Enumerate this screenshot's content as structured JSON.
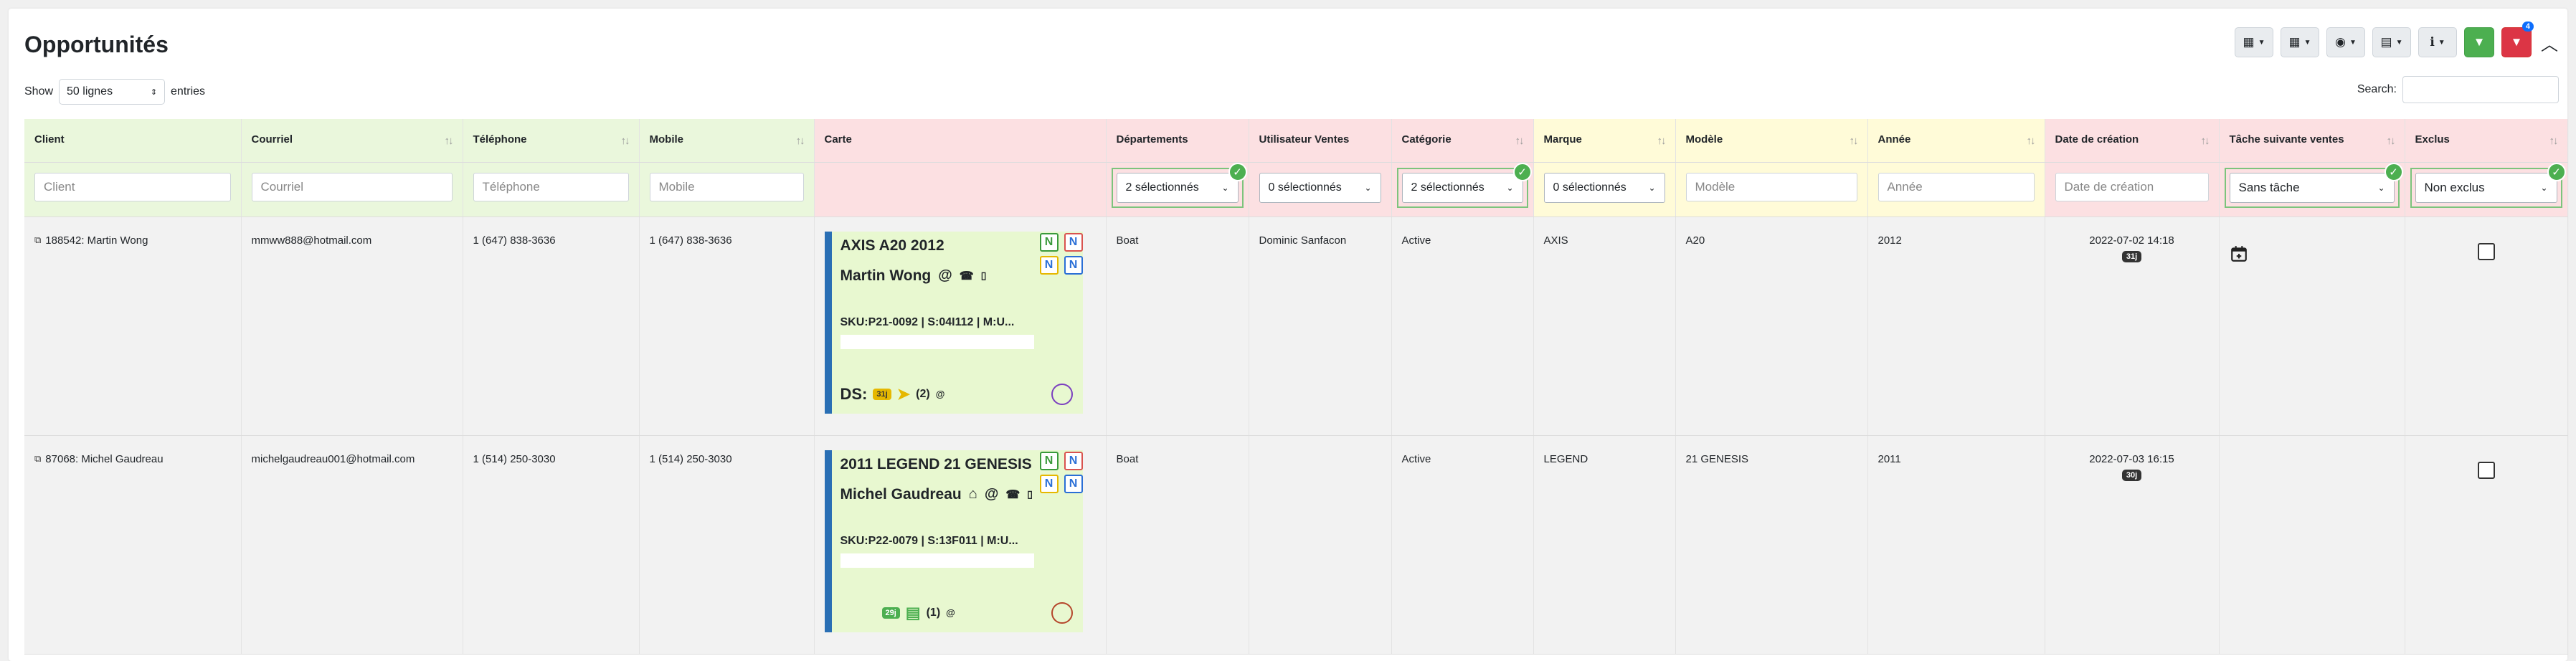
{
  "page": {
    "title": "Opportunités"
  },
  "toolbar": {
    "filter_count": "4"
  },
  "length": {
    "show": "Show",
    "value": "50 lignes",
    "entries": "entries"
  },
  "search": {
    "label": "Search:"
  },
  "columns": [
    {
      "label": "Client"
    },
    {
      "label": "Courriel"
    },
    {
      "label": "Téléphone"
    },
    {
      "label": "Mobile"
    },
    {
      "label": "Carte"
    },
    {
      "label": "Départements"
    },
    {
      "label": "Utilisateur Ventes"
    },
    {
      "label": "Catégorie"
    },
    {
      "label": "Marque"
    },
    {
      "label": "Modèle"
    },
    {
      "label": "Année"
    },
    {
      "label": "Date de création"
    },
    {
      "label": "Tâche suivante ventes"
    },
    {
      "label": "Exclus"
    }
  ],
  "filters": {
    "client": "Client",
    "courriel": "Courriel",
    "telephone": "Téléphone",
    "mobile": "Mobile",
    "departements": "2 sélectionnés",
    "utilisateur": "0 sélectionnés",
    "categorie": "2 sélectionnés",
    "marque": "0 sélectionnés",
    "modele": "Modèle",
    "annee": "Année",
    "date": "Date de création",
    "tache": "Sans tâche",
    "exclus": "Non exclus"
  },
  "rows": [
    {
      "client": "188542: Martin Wong",
      "courriel": "mmww888@hotmail.com",
      "telephone": "1 (647) 838-3636",
      "mobile": "1 (647) 838-3636",
      "card": {
        "title": "AXIS A20 2012",
        "name": "Martin Wong",
        "sku": "SKU:P21-0092 | S:04I112 | M:U...",
        "prefix": "DS:",
        "badge": "31j",
        "count": "(2)"
      },
      "departement": "Boat",
      "utilisateur": "Dominic Sanfacon",
      "categorie": "Active",
      "marque": "AXIS",
      "modele": "A20",
      "annee": "2012",
      "date": "2022-07-02 14:18",
      "date_badge": "31j"
    },
    {
      "client": "87068: Michel Gaudreau",
      "courriel": "michelgaudreau001@hotmail.com",
      "telephone": "1 (514) 250-3030",
      "mobile": "1 (514) 250-3030",
      "card": {
        "title": "2011 LEGEND 21 GENESIS",
        "name": "Michel Gaudreau",
        "sku": "SKU:P22-0079 | S:13F011 | M:U...",
        "badge": "29j",
        "count": "(1)"
      },
      "departement": "Boat",
      "utilisateur": "",
      "categorie": "Active",
      "marque": "LEGEND",
      "modele": "21 GENESIS",
      "annee": "2011",
      "date": "2022-07-03 16:15",
      "date_badge": "30j"
    }
  ],
  "colors": {
    "green": "#4caf50",
    "red": "#dc3545",
    "card_bg": "#e8f8d0",
    "card_border": "#2a6fb4",
    "n_green": "#3a9a3a",
    "n_red": "#d9534f",
    "n_yellow": "#e6b800",
    "n_blue": "#2a6fd6"
  }
}
